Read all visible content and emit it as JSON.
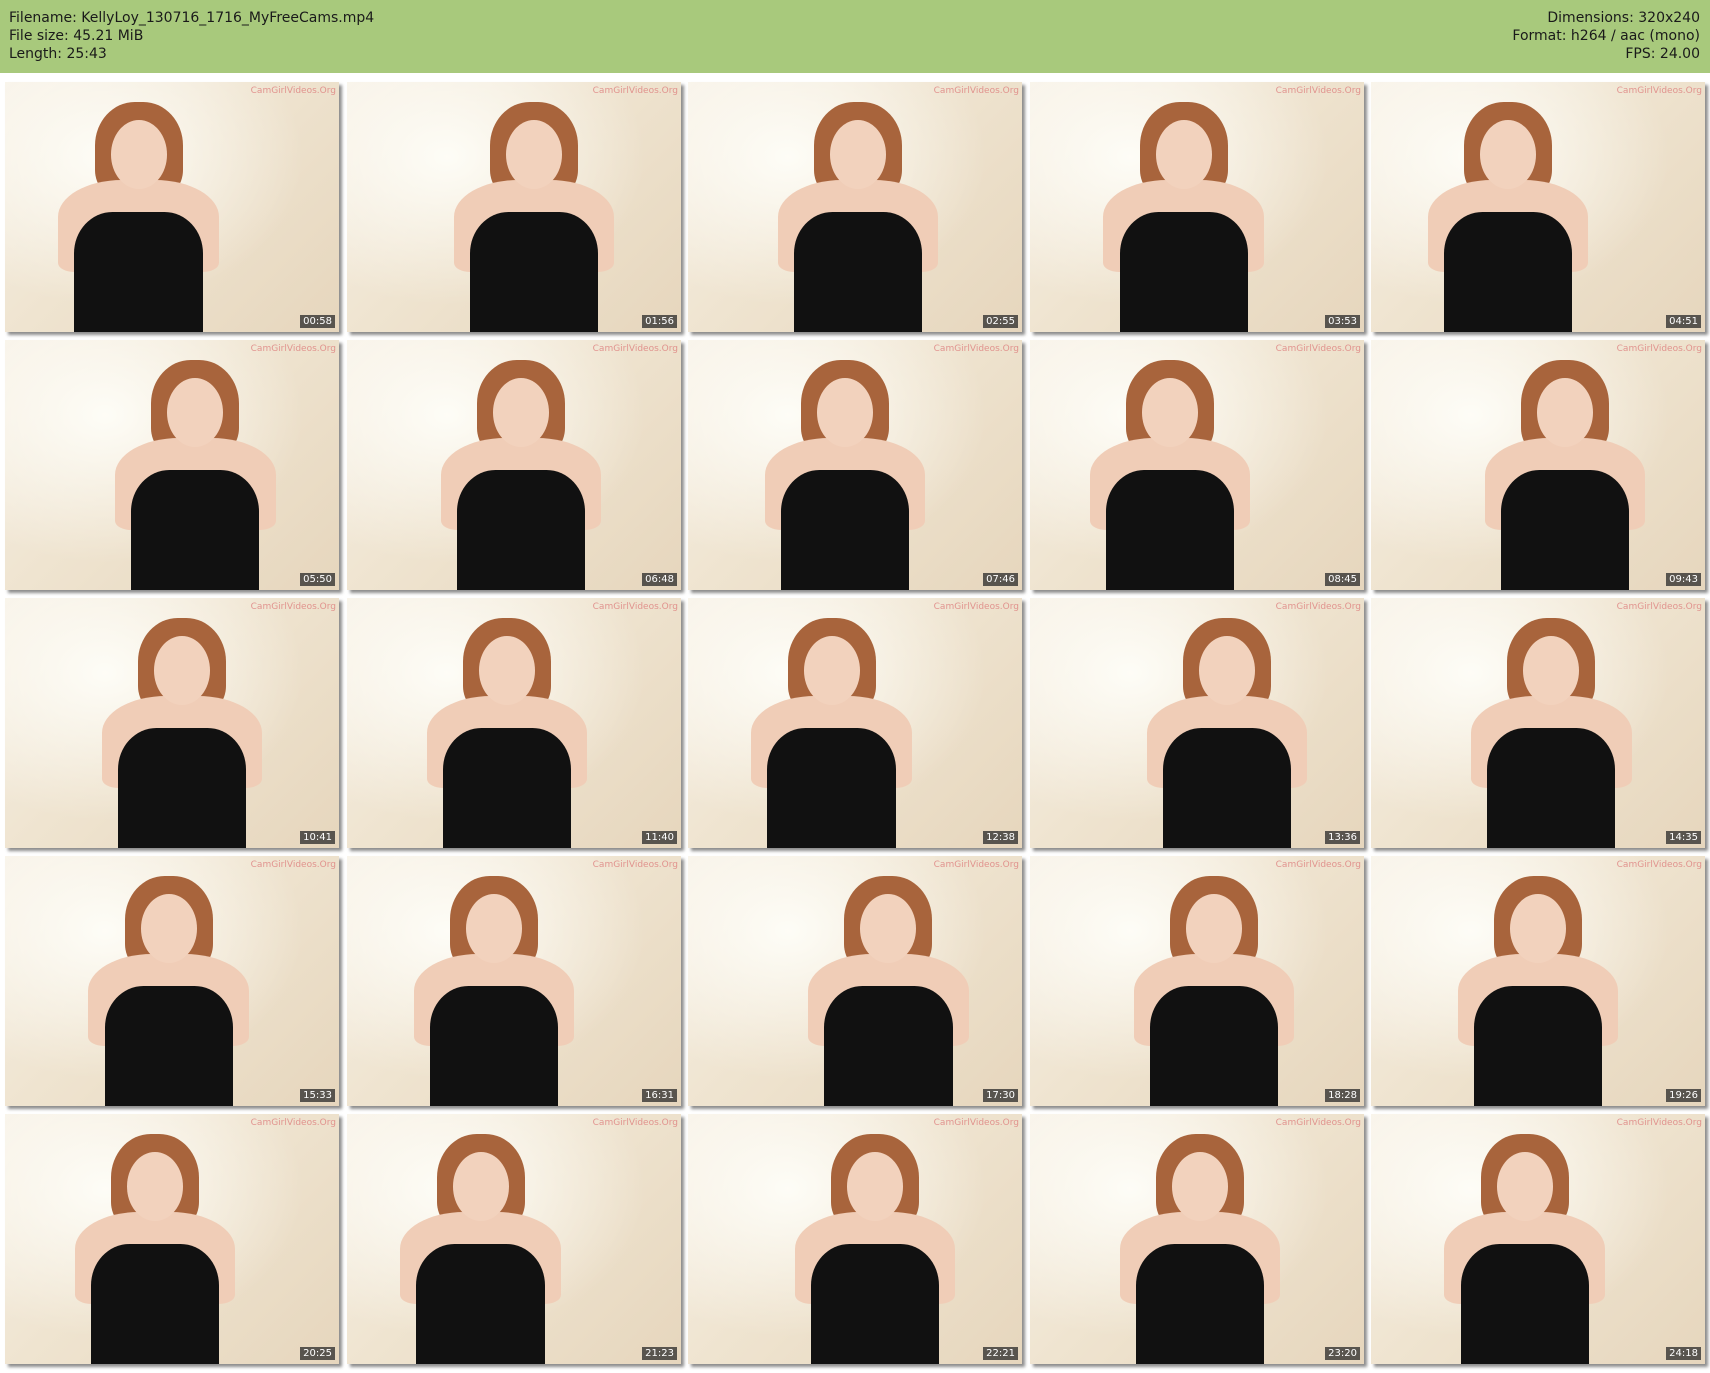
{
  "header": {
    "filename_label": "Filename: KellyLoy_130716_1716_MyFreeCams.mp4",
    "filesize_label": "File size: 45.21 MiB",
    "length_label": "Length: 25:43",
    "dimensions_label": "Dimensions: 320x240",
    "format_label": "Format: h264 / aac (mono)",
    "fps_label": "FPS: 24.00"
  },
  "watermark": "CamGirlVideos.Org",
  "thumbnails": [
    {
      "time": "00:58"
    },
    {
      "time": "01:56"
    },
    {
      "time": "02:55"
    },
    {
      "time": "03:53"
    },
    {
      "time": "04:51"
    },
    {
      "time": "05:50"
    },
    {
      "time": "06:48"
    },
    {
      "time": "07:46"
    },
    {
      "time": "08:45"
    },
    {
      "time": "09:43"
    },
    {
      "time": "10:41"
    },
    {
      "time": "11:40"
    },
    {
      "time": "12:38"
    },
    {
      "time": "13:36"
    },
    {
      "time": "14:35"
    },
    {
      "time": "15:33"
    },
    {
      "time": "16:31"
    },
    {
      "time": "17:30"
    },
    {
      "time": "18:28"
    },
    {
      "time": "19:26"
    },
    {
      "time": "20:25"
    },
    {
      "time": "21:23"
    },
    {
      "time": "22:21"
    },
    {
      "time": "23:20"
    },
    {
      "time": "24:18"
    }
  ]
}
